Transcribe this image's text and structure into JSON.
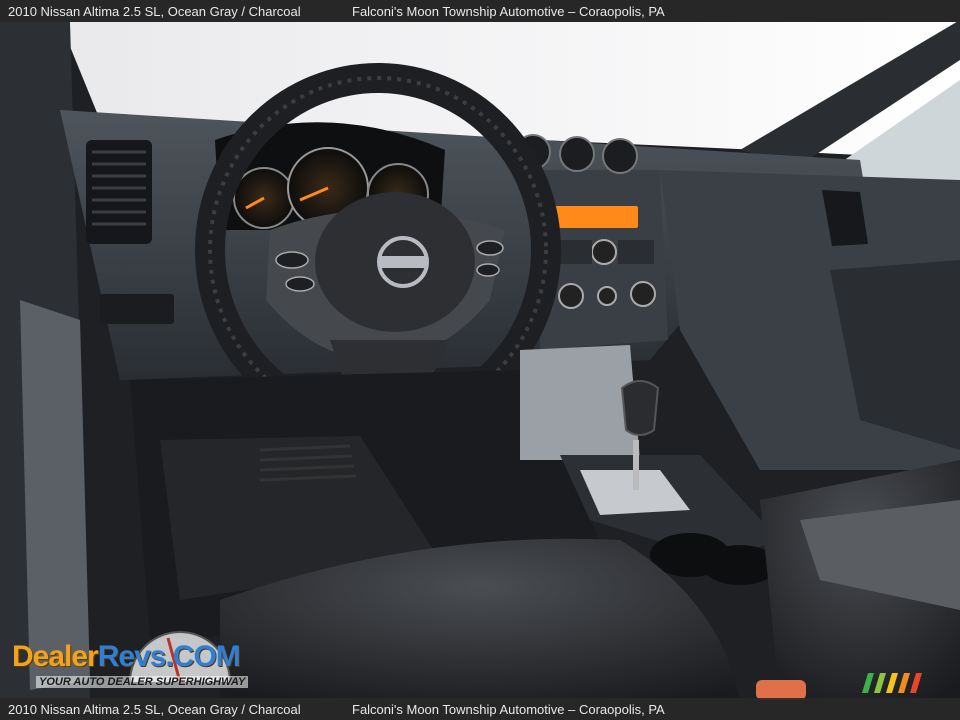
{
  "caption": {
    "vehicle": "2010 Nissan Altima 2.5 SL,  Ocean Gray / Charcoal",
    "dealer": "Falconi's Moon Township Automotive – Coraopolis, PA"
  },
  "logo": {
    "brand_part1": "Dealer",
    "brand_part2": "Revs",
    "brand_part3": ".COM",
    "tagline": "YOUR AUTO DEALER SUPERHIGHWAY"
  },
  "icons": {
    "steering_wheel": "steering-wheel-icon",
    "gear_shifter": "gear-shifter-icon",
    "speedometer": "speedometer-icon"
  },
  "colors": {
    "accent_orange": "#f2a31a",
    "accent_blue": "#2f7fd8",
    "radio_display": "#ff8a1a"
  }
}
